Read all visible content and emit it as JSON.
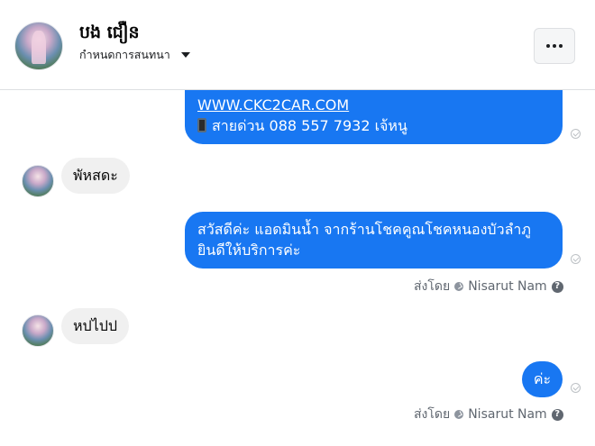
{
  "header": {
    "contact_name": "បង ជឿន",
    "subtitle": "กำหนดการสนทนา",
    "more_button_icon": "more-horizontal-icon"
  },
  "messages": [
    {
      "type": "outgoing",
      "link": "WWW.CKC2CAR.COM",
      "line2_icon": "phone-icon",
      "line2": "สายด่วน 088 557 7932 เจ้หนู"
    },
    {
      "type": "incoming",
      "text": "พัหสดะ"
    },
    {
      "type": "outgoing",
      "line1": "สวัสดีค่ะ แอดมินน้ำ จากร้านโชคคูณโชคหนองบัวลำภู",
      "line2": "ยินดีให้บริการค่ะ",
      "sent_by_label": "ส่งโดย",
      "sent_by_name": "Nisarut Nam"
    },
    {
      "type": "incoming",
      "text": "หปไปป"
    },
    {
      "type": "outgoing",
      "text": "ค่ะ",
      "sent_by_label": "ส่งโดย",
      "sent_by_name": "Nisarut Nam"
    }
  ],
  "colors": {
    "outgoing_bubble": "#1877f2",
    "incoming_bubble": "#f0f0f0",
    "meta_text": "#606770"
  }
}
